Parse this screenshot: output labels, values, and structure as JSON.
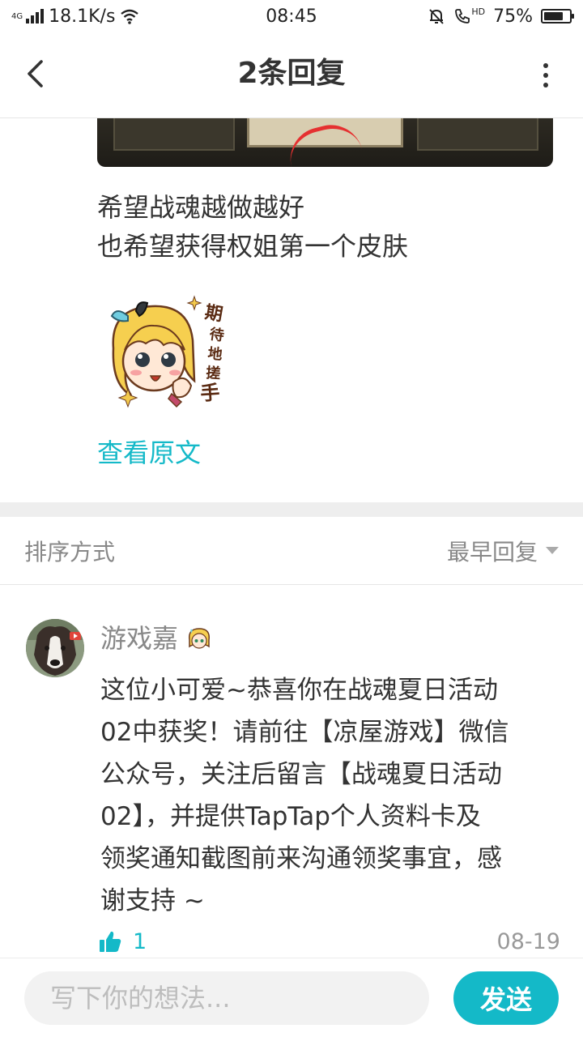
{
  "status_bar": {
    "network": "4G",
    "speed": "18.1K/s",
    "time": "08:45",
    "hd_label": "HD",
    "battery": "75%",
    "battery_level": 0.75
  },
  "header": {
    "title": "2条回复",
    "back_icon": "chevron-left-icon",
    "more_icon": "more-vertical-icon"
  },
  "post": {
    "lines": [
      "希望战魂越做越好",
      "也希望获得权姐第一个皮肤"
    ],
    "sticker_text": [
      "期",
      "待",
      "地",
      "搓",
      "手"
    ],
    "view_original": "查看原文"
  },
  "sort": {
    "label": "排序方式",
    "selected": "最早回复"
  },
  "reply": {
    "username": "游戏嘉",
    "body_lines": [
      "这位小可爱~恭喜你在战魂夏日活动",
      "02中获奖！请前往【凉屋游戏】微信",
      "公众号，关注后留言【战魂夏日活动",
      "02】，并提供TapTap个人资料卡及",
      "领奖通知截图前来沟通领奖事宜，感",
      "谢支持 ~"
    ],
    "likes": "1",
    "date": "08-19"
  },
  "composer": {
    "placeholder": "写下你的想法...",
    "send_label": "发送"
  },
  "colors": {
    "accent": "#14b9c8",
    "text": "#333333",
    "muted": "#888888",
    "divider": "#eeeeee"
  }
}
